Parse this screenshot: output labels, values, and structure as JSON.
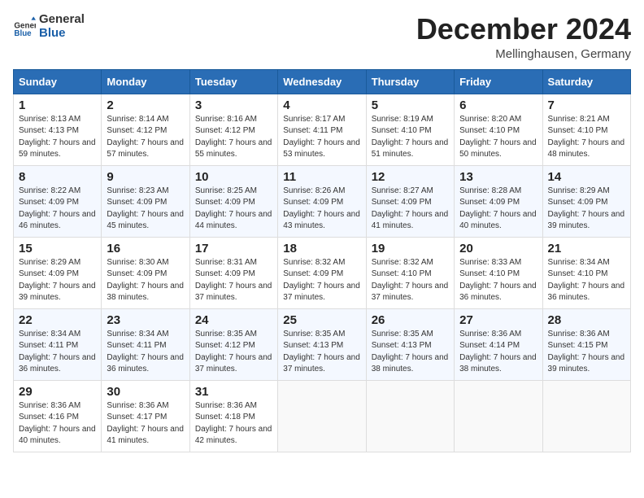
{
  "header": {
    "logo_text_general": "General",
    "logo_text_blue": "Blue",
    "month_title": "December 2024",
    "subtitle": "Mellinghausen, Germany"
  },
  "weekdays": [
    "Sunday",
    "Monday",
    "Tuesday",
    "Wednesday",
    "Thursday",
    "Friday",
    "Saturday"
  ],
  "weeks": [
    [
      {
        "day": "1",
        "sunrise": "8:13 AM",
        "sunset": "4:13 PM",
        "daylight": "7 hours and 59 minutes."
      },
      {
        "day": "2",
        "sunrise": "8:14 AM",
        "sunset": "4:12 PM",
        "daylight": "7 hours and 57 minutes."
      },
      {
        "day": "3",
        "sunrise": "8:16 AM",
        "sunset": "4:12 PM",
        "daylight": "7 hours and 55 minutes."
      },
      {
        "day": "4",
        "sunrise": "8:17 AM",
        "sunset": "4:11 PM",
        "daylight": "7 hours and 53 minutes."
      },
      {
        "day": "5",
        "sunrise": "8:19 AM",
        "sunset": "4:10 PM",
        "daylight": "7 hours and 51 minutes."
      },
      {
        "day": "6",
        "sunrise": "8:20 AM",
        "sunset": "4:10 PM",
        "daylight": "7 hours and 50 minutes."
      },
      {
        "day": "7",
        "sunrise": "8:21 AM",
        "sunset": "4:10 PM",
        "daylight": "7 hours and 48 minutes."
      }
    ],
    [
      {
        "day": "8",
        "sunrise": "8:22 AM",
        "sunset": "4:09 PM",
        "daylight": "7 hours and 46 minutes."
      },
      {
        "day": "9",
        "sunrise": "8:23 AM",
        "sunset": "4:09 PM",
        "daylight": "7 hours and 45 minutes."
      },
      {
        "day": "10",
        "sunrise": "8:25 AM",
        "sunset": "4:09 PM",
        "daylight": "7 hours and 44 minutes."
      },
      {
        "day": "11",
        "sunrise": "8:26 AM",
        "sunset": "4:09 PM",
        "daylight": "7 hours and 43 minutes."
      },
      {
        "day": "12",
        "sunrise": "8:27 AM",
        "sunset": "4:09 PM",
        "daylight": "7 hours and 41 minutes."
      },
      {
        "day": "13",
        "sunrise": "8:28 AM",
        "sunset": "4:09 PM",
        "daylight": "7 hours and 40 minutes."
      },
      {
        "day": "14",
        "sunrise": "8:29 AM",
        "sunset": "4:09 PM",
        "daylight": "7 hours and 39 minutes."
      }
    ],
    [
      {
        "day": "15",
        "sunrise": "8:29 AM",
        "sunset": "4:09 PM",
        "daylight": "7 hours and 39 minutes."
      },
      {
        "day": "16",
        "sunrise": "8:30 AM",
        "sunset": "4:09 PM",
        "daylight": "7 hours and 38 minutes."
      },
      {
        "day": "17",
        "sunrise": "8:31 AM",
        "sunset": "4:09 PM",
        "daylight": "7 hours and 37 minutes."
      },
      {
        "day": "18",
        "sunrise": "8:32 AM",
        "sunset": "4:09 PM",
        "daylight": "7 hours and 37 minutes."
      },
      {
        "day": "19",
        "sunrise": "8:32 AM",
        "sunset": "4:10 PM",
        "daylight": "7 hours and 37 minutes."
      },
      {
        "day": "20",
        "sunrise": "8:33 AM",
        "sunset": "4:10 PM",
        "daylight": "7 hours and 36 minutes."
      },
      {
        "day": "21",
        "sunrise": "8:34 AM",
        "sunset": "4:10 PM",
        "daylight": "7 hours and 36 minutes."
      }
    ],
    [
      {
        "day": "22",
        "sunrise": "8:34 AM",
        "sunset": "4:11 PM",
        "daylight": "7 hours and 36 minutes."
      },
      {
        "day": "23",
        "sunrise": "8:34 AM",
        "sunset": "4:11 PM",
        "daylight": "7 hours and 36 minutes."
      },
      {
        "day": "24",
        "sunrise": "8:35 AM",
        "sunset": "4:12 PM",
        "daylight": "7 hours and 37 minutes."
      },
      {
        "day": "25",
        "sunrise": "8:35 AM",
        "sunset": "4:13 PM",
        "daylight": "7 hours and 37 minutes."
      },
      {
        "day": "26",
        "sunrise": "8:35 AM",
        "sunset": "4:13 PM",
        "daylight": "7 hours and 38 minutes."
      },
      {
        "day": "27",
        "sunrise": "8:36 AM",
        "sunset": "4:14 PM",
        "daylight": "7 hours and 38 minutes."
      },
      {
        "day": "28",
        "sunrise": "8:36 AM",
        "sunset": "4:15 PM",
        "daylight": "7 hours and 39 minutes."
      }
    ],
    [
      {
        "day": "29",
        "sunrise": "8:36 AM",
        "sunset": "4:16 PM",
        "daylight": "7 hours and 40 minutes."
      },
      {
        "day": "30",
        "sunrise": "8:36 AM",
        "sunset": "4:17 PM",
        "daylight": "7 hours and 41 minutes."
      },
      {
        "day": "31",
        "sunrise": "8:36 AM",
        "sunset": "4:18 PM",
        "daylight": "7 hours and 42 minutes."
      },
      null,
      null,
      null,
      null
    ]
  ],
  "labels": {
    "sunrise": "Sunrise: ",
    "sunset": "Sunset: ",
    "daylight": "Daylight: "
  }
}
